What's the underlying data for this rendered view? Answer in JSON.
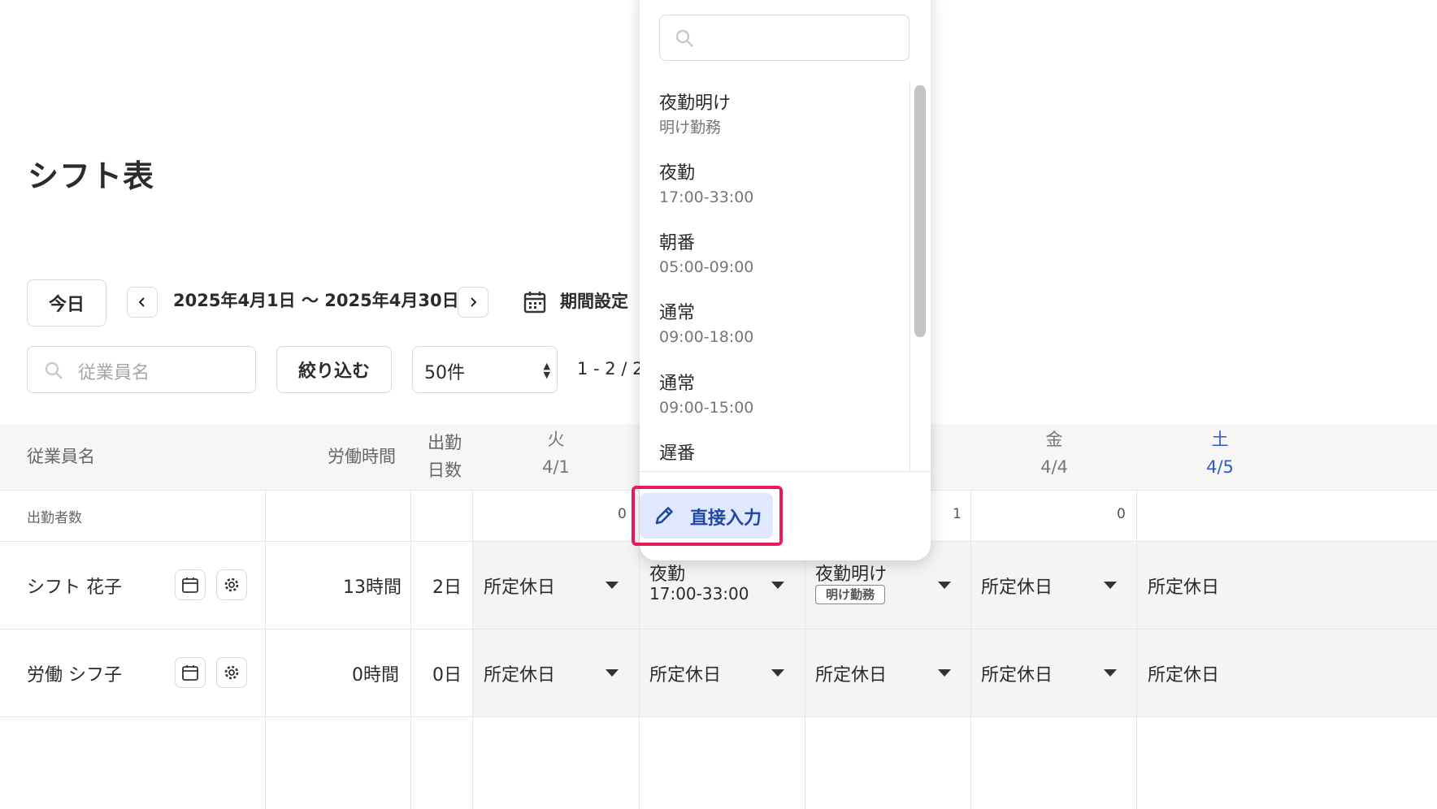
{
  "page": {
    "title": "シフト表"
  },
  "toolbar": {
    "today_label": "今日",
    "date_range": "2025年4月1日 〜 2025年4月30日",
    "period_label": "期間設定",
    "search_placeholder": "従業員名",
    "filter_label": "絞り込む",
    "per_page": "50件",
    "page_count": "1 - 2 / 2"
  },
  "table": {
    "headers": {
      "employee": "従業員名",
      "hours": "労働時間",
      "days_line1": "出勤",
      "days_line2": "日数"
    },
    "days": [
      {
        "weekday": "火",
        "date": "4/1"
      },
      {
        "weekday": "金",
        "date": "4/4"
      },
      {
        "weekday": "土",
        "date": "4/5"
      }
    ],
    "attendance_row": {
      "label": "出勤者数",
      "counts": [
        "0",
        "1",
        "0"
      ]
    },
    "rows": [
      {
        "name": "シフト 花子",
        "hours": "13時間",
        "days": "2日",
        "shifts": [
          {
            "name": "所定休日"
          },
          {
            "name": "夜勤",
            "detail": "17:00-33:00"
          },
          {
            "name": "夜勤明け",
            "badge": "明け勤務"
          },
          {
            "name": "所定休日"
          },
          {
            "name": "所定休日"
          }
        ]
      },
      {
        "name": "労働 シフ子",
        "hours": "0時間",
        "days": "0日",
        "shifts": [
          {
            "name": "所定休日"
          },
          {
            "name": "所定休日"
          },
          {
            "name": "所定休日"
          },
          {
            "name": "所定休日"
          },
          {
            "name": "所定休日"
          }
        ]
      }
    ]
  },
  "dropdown": {
    "search_value": "",
    "options": [
      {
        "name": "夜勤明け",
        "detail": "明け勤務"
      },
      {
        "name": "夜勤",
        "detail": "17:00-33:00"
      },
      {
        "name": "朝番",
        "detail": "05:00-09:00"
      },
      {
        "name": "通常",
        "detail": "09:00-18:00"
      },
      {
        "name": "通常",
        "detail": "09:00-15:00"
      },
      {
        "name": "遅番",
        "detail": ""
      }
    ],
    "direct_input_label": "直接入力"
  },
  "colors": {
    "accent": "#2148a3",
    "highlight": "#e8195c",
    "saturday": "#2a5cc7",
    "header_bg": "#f8f6f4"
  }
}
